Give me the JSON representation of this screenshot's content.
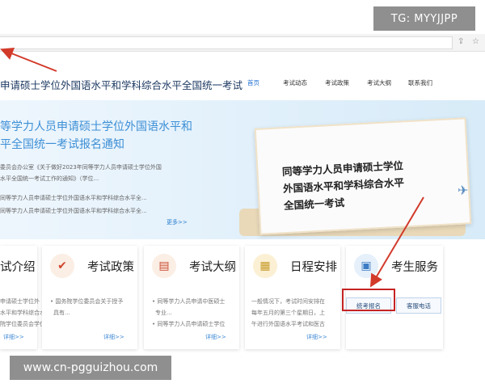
{
  "watermark_top": "TG: MYYJJPP",
  "watermark_bottom": "www.cn-pgguizhou.com",
  "site": {
    "title": "申请硕士学位外国语水平和学科综合水平全国统一考试",
    "nav": [
      "首页",
      "考试动态",
      "考试政策",
      "考试大纲",
      "联系我们"
    ]
  },
  "banner": {
    "title_line1": "等学力人员申请硕士学位外国语水平和",
    "title_line2": "平全国统一考试报名通知",
    "sub_line1": "委员会办公室《关于做好2023年同等学力人员申请硕士学位外国",
    "sub_line2": "水平全国统一考试工作的通知》（学位...",
    "sub_line3": "同等学力人员申请硕士学位外国语水平和学科综合水平全...",
    "sub_line4": "同等学力人员申请硕士学位外国语水平和学科综合水平全...",
    "more": "更多>>",
    "board_line1": "同等学力人员申请硕士学位",
    "board_line2": "外国语水平和学科综合水平",
    "board_line3": "全国统一考试"
  },
  "cards": [
    {
      "title": "试介绍",
      "icon": "info-icon",
      "lines": [
        "申请硕士学位外",
        "水平和学科综合水平全国",
        "院学位委员会学位委"
      ],
      "more": "详细>>"
    },
    {
      "title": "考试政策",
      "icon": "checkmark-icon",
      "lines": [
        "• 国务院学位委员会关于授予",
        "具有..."
      ],
      "more": "详细>>"
    },
    {
      "title": "考试大纲",
      "icon": "document-icon",
      "lines": [
        "• 同等学力人员申请中医硕士",
        "专业...",
        "• 同等学力人员申请硕士学位"
      ],
      "more": "详细>>"
    },
    {
      "title": "日程安排",
      "icon": "calendar-icon",
      "lines": [
        "一般情况下，考试时间安排在",
        "每年五月的第三个星期日，上",
        "午进行外国语水平考试和医古"
      ],
      "more": "详细>>"
    },
    {
      "title": "考生服务",
      "icon": "id-card-icon",
      "buttons": [
        "统考报名",
        "客服电话"
      ]
    }
  ],
  "colors": {
    "accent": "#3d8fd6",
    "highlight_box": "#c52424",
    "arrow": "#d23a2a"
  }
}
